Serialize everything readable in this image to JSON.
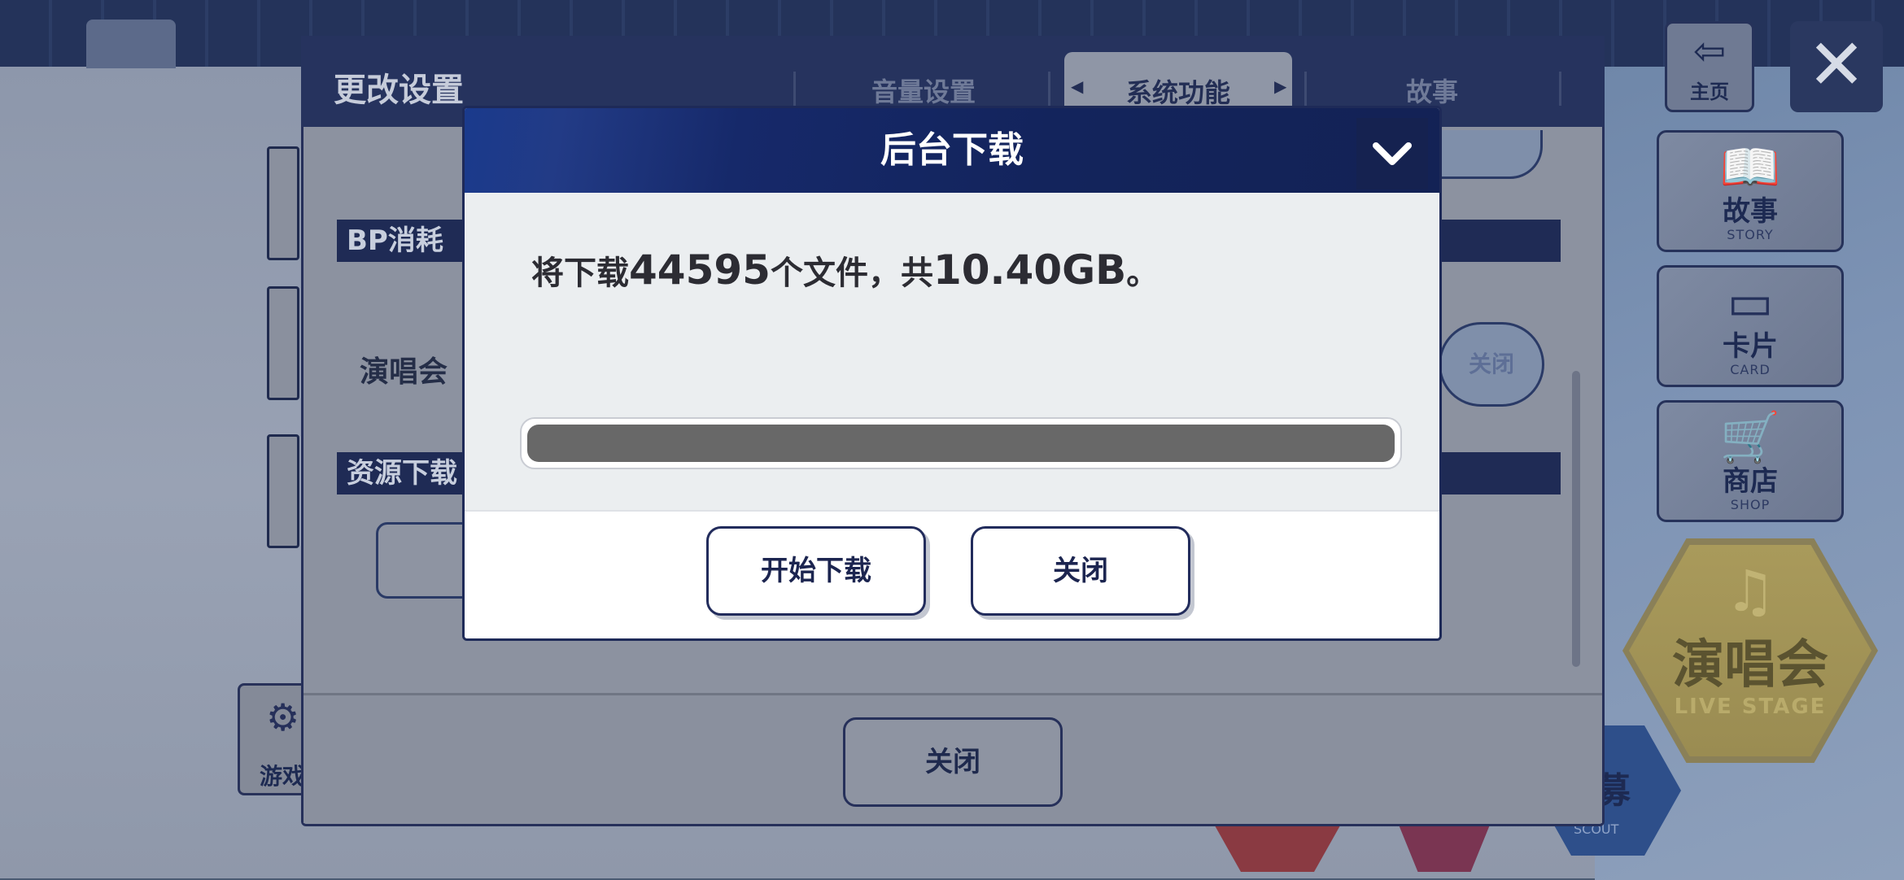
{
  "top_bar": {
    "home_label": "主页",
    "close_glyph": "✕"
  },
  "side_menu": [
    {
      "label": "故事",
      "sub": "STORY",
      "icon": "book-icon"
    },
    {
      "label": "卡片",
      "sub": "CARD",
      "icon": "card-icon"
    },
    {
      "label": "商店",
      "sub": "SHOP",
      "icon": "cart-icon"
    }
  ],
  "live_stage": {
    "label": "演唱会",
    "sub": "LIVE STAGE"
  },
  "scout": {
    "label": "募",
    "sub": "SCOUT"
  },
  "left_menu": {
    "game_label": "游戏"
  },
  "settings": {
    "title": "更改设置",
    "tabs": [
      {
        "label": "音量设置"
      },
      {
        "label": "系统功能",
        "active": true
      },
      {
        "label": "故事"
      }
    ],
    "section_bp": "BP消耗",
    "row_concert": "演唱会",
    "row_concert_value": "关闭",
    "section_resources": "资源下载",
    "footer_close": "关闭"
  },
  "dialog": {
    "title": "后台下载",
    "msg_prefix": "将下载",
    "file_count": "44595",
    "msg_mid": "个文件，共",
    "total_size": "10.40GB",
    "msg_suffix": "。",
    "progress_fraction": 1.0,
    "start_button": "开始下载",
    "close_button": "关闭"
  },
  "colors": {
    "dialog_header": "#13245c",
    "button_border": "#222c5c",
    "progress_fill": "#686868"
  }
}
